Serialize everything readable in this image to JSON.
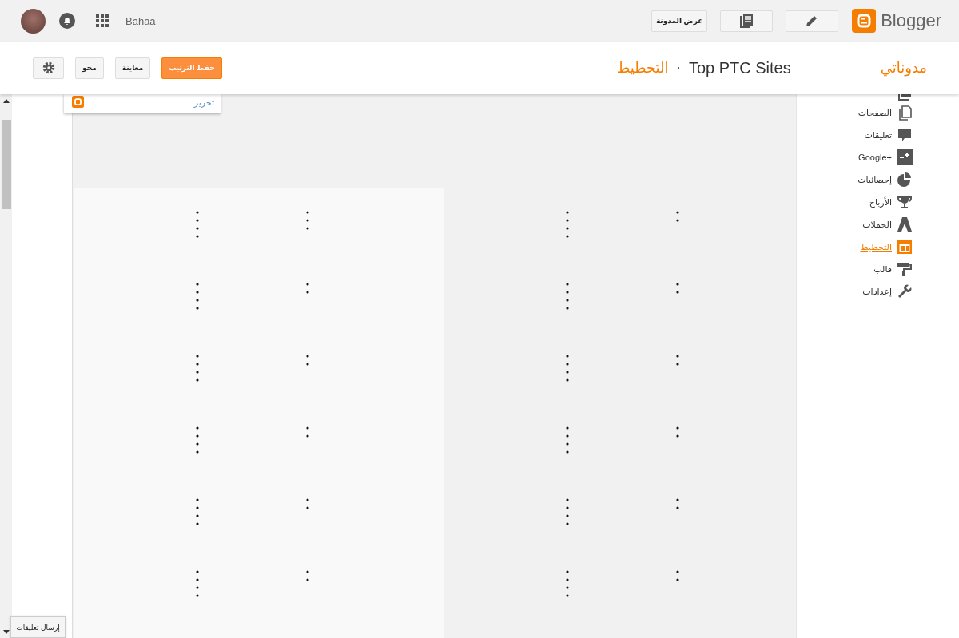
{
  "topbar": {
    "user": "Bahaa",
    "view_blog": "عرض المدونة",
    "brand": "Blogger"
  },
  "header": {
    "my_blogs": "مدوناتي",
    "blog_title": "Top PTC Sites",
    "separator": "·",
    "section": "التخطيط",
    "buttons": [
      {
        "label": "حفظ الترتيب",
        "kind": "primary"
      },
      {
        "label": "معاينة",
        "kind": "plain"
      },
      {
        "label": "محو",
        "kind": "plain"
      }
    ]
  },
  "sidebar": {
    "items": [
      {
        "label": "الصفحات",
        "selected": false
      },
      {
        "label": "تعليقات",
        "selected": false
      },
      {
        "label": "Google+",
        "selected": false
      },
      {
        "label": "إحصائيات",
        "selected": false
      },
      {
        "label": "الأرباح",
        "selected": false
      },
      {
        "label": "الحملات",
        "selected": false
      },
      {
        "label": "التخطيط",
        "selected": true
      },
      {
        "label": "قالب",
        "selected": false
      },
      {
        "label": "إعدادات",
        "selected": false
      }
    ]
  },
  "edit_popup": {
    "link": "تحرير"
  },
  "feedback_button": "إرسال تعليقات"
}
